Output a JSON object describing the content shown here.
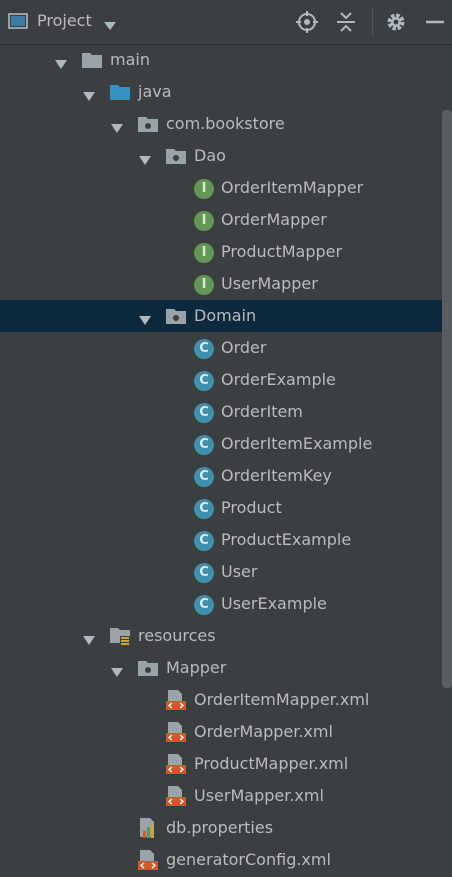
{
  "header": {
    "title": "Project",
    "icons": [
      "project-view-icon",
      "dropdown-caret-icon",
      "locate-icon",
      "collapse-all-icon",
      "settings-gear-icon",
      "hide-minus-icon"
    ]
  },
  "colors": {
    "background": "#3c3f41",
    "selection": "#0d293e",
    "text": "#bbbbbb",
    "interface_badge": "#629755",
    "class_badge": "#3f8fae",
    "xml_icon": "#d4572b"
  },
  "tree": {
    "items": [
      {
        "label": "main",
        "type": "folder-gray",
        "expanded": true
      },
      {
        "label": "java",
        "type": "folder-blue",
        "expanded": true
      },
      {
        "label": "com.bookstore",
        "type": "package",
        "expanded": true
      },
      {
        "label": "Dao",
        "type": "package",
        "expanded": true
      },
      {
        "label": "OrderItemMapper",
        "type": "interface",
        "badge": "I"
      },
      {
        "label": "OrderMapper",
        "type": "interface",
        "badge": "I"
      },
      {
        "label": "ProductMapper",
        "type": "interface",
        "badge": "I"
      },
      {
        "label": "UserMapper",
        "type": "interface",
        "badge": "I"
      },
      {
        "label": "Domain",
        "type": "package",
        "expanded": true,
        "selected": true
      },
      {
        "label": "Order",
        "type": "class",
        "badge": "C"
      },
      {
        "label": "OrderExample",
        "type": "class",
        "badge": "C"
      },
      {
        "label": "OrderItem",
        "type": "class",
        "badge": "C"
      },
      {
        "label": "OrderItemExample",
        "type": "class",
        "badge": "C"
      },
      {
        "label": "OrderItemKey",
        "type": "class",
        "badge": "C"
      },
      {
        "label": "Product",
        "type": "class",
        "badge": "C"
      },
      {
        "label": "ProductExample",
        "type": "class",
        "badge": "C"
      },
      {
        "label": "User",
        "type": "class",
        "badge": "C"
      },
      {
        "label": "UserExample",
        "type": "class",
        "badge": "C"
      },
      {
        "label": "resources",
        "type": "resources-folder",
        "expanded": true
      },
      {
        "label": "Mapper",
        "type": "package",
        "expanded": true
      },
      {
        "label": "OrderItemMapper.xml",
        "type": "xml"
      },
      {
        "label": "OrderMapper.xml",
        "type": "xml"
      },
      {
        "label": "ProductMapper.xml",
        "type": "xml"
      },
      {
        "label": "UserMapper.xml",
        "type": "xml"
      },
      {
        "label": "db.properties",
        "type": "properties"
      },
      {
        "label": "generatorConfig.xml",
        "type": "xml"
      }
    ]
  }
}
